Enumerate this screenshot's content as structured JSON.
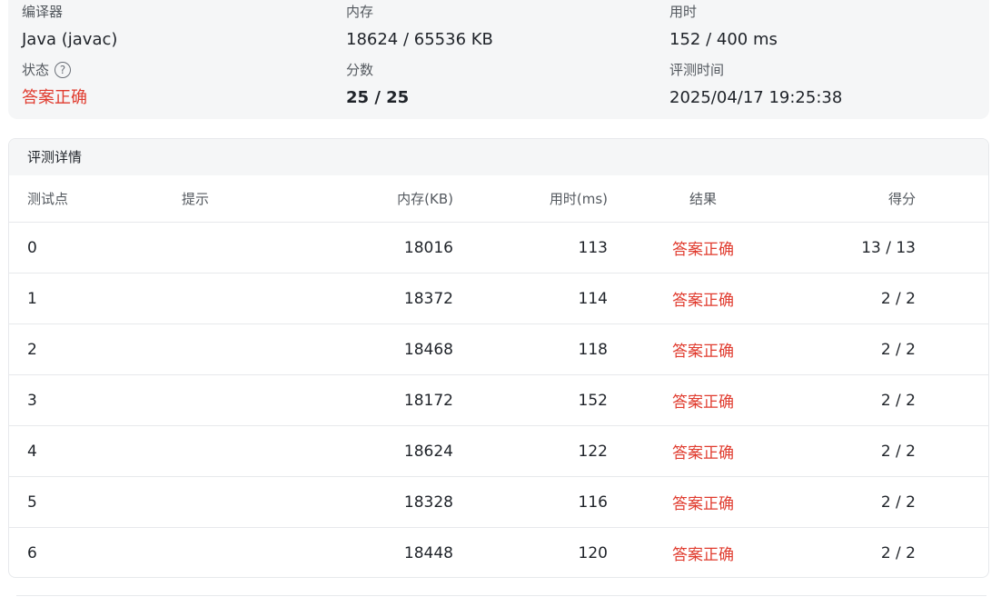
{
  "summary": {
    "compiler_label": "编译器",
    "compiler_value": "Java (javac)",
    "memory_label": "内存",
    "memory_value": "18624 / 65536 KB",
    "time_label": "用时",
    "time_value": "152 / 400 ms",
    "status_label": "状态",
    "status_value": "答案正确",
    "score_label": "分数",
    "score_value": "25 / 25",
    "judge_time_label": "评测时间",
    "judge_time_value": "2025/04/17 19:25:38",
    "help_icon": "help-circle-icon"
  },
  "details": {
    "title": "评测详情",
    "headers": {
      "id": "测试点",
      "hint": "提示",
      "memory": "内存(KB)",
      "time": "用时(ms)",
      "result": "结果",
      "score": "得分"
    },
    "rows": [
      {
        "id": "0",
        "hint": "",
        "memory": "18016",
        "time": "113",
        "result": "答案正确",
        "score": "13 / 13"
      },
      {
        "id": "1",
        "hint": "",
        "memory": "18372",
        "time": "114",
        "result": "答案正确",
        "score": "2 / 2"
      },
      {
        "id": "2",
        "hint": "",
        "memory": "18468",
        "time": "118",
        "result": "答案正确",
        "score": "2 / 2"
      },
      {
        "id": "3",
        "hint": "",
        "memory": "18172",
        "time": "152",
        "result": "答案正确",
        "score": "2 / 2"
      },
      {
        "id": "4",
        "hint": "",
        "memory": "18624",
        "time": "122",
        "result": "答案正确",
        "score": "2 / 2"
      },
      {
        "id": "5",
        "hint": "",
        "memory": "18328",
        "time": "116",
        "result": "答案正确",
        "score": "2 / 2"
      },
      {
        "id": "6",
        "hint": "",
        "memory": "18448",
        "time": "120",
        "result": "答案正确",
        "score": "2 / 2"
      }
    ]
  },
  "colors": {
    "accepted": "#e03b2e",
    "panel_bg": "#f5f6f7"
  }
}
